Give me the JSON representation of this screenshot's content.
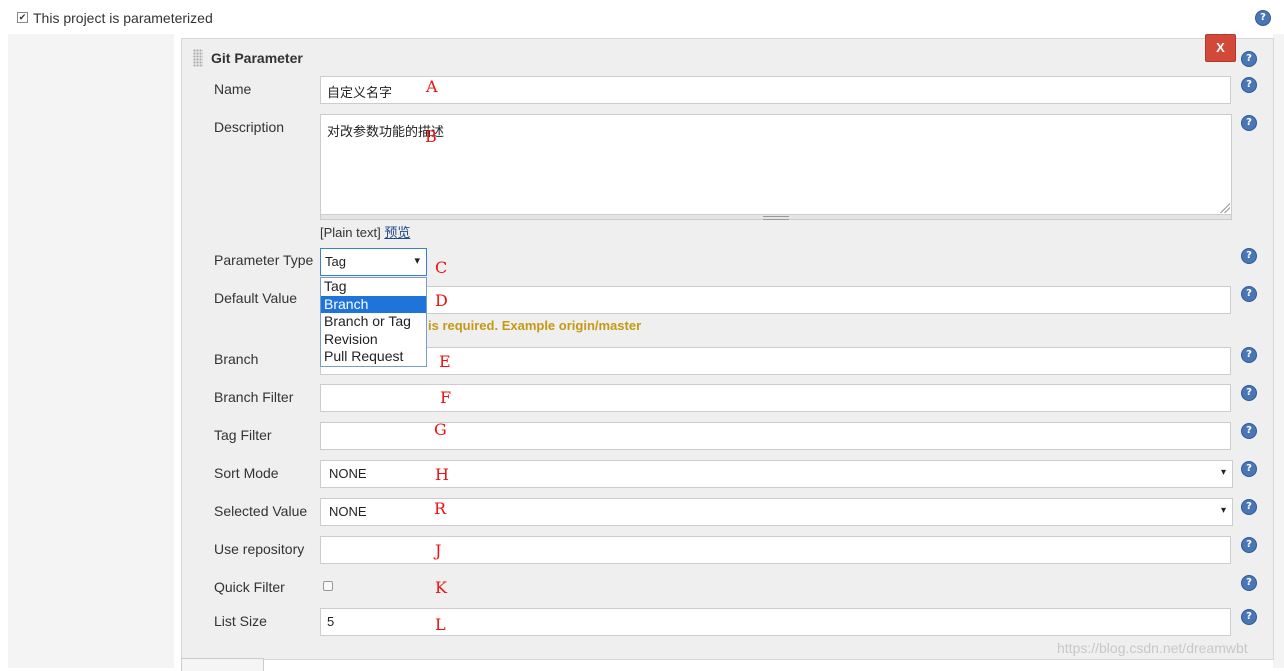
{
  "header": {
    "checkbox_label": "This project is parameterized",
    "checked": true
  },
  "panel": {
    "title": "Git Parameter",
    "delete_label": "X"
  },
  "fields": {
    "name": {
      "label": "Name",
      "value": "自定义名字"
    },
    "description": {
      "label": "Description",
      "value": "对改参数功能的描述",
      "plain_text": "[Plain text]",
      "preview_link": "预览"
    },
    "parameter_type": {
      "label": "Parameter Type",
      "value": "Tag",
      "options": [
        "Tag",
        "Branch",
        "Branch or Tag",
        "Revision",
        "Pull Request"
      ],
      "highlighted": "Branch"
    },
    "default_value": {
      "label": "Default Value",
      "warning": "is required. Example origin/master"
    },
    "branch": {
      "label": "Branch"
    },
    "branch_filter": {
      "label": "Branch Filter"
    },
    "tag_filter": {
      "label": "Tag Filter"
    },
    "sort_mode": {
      "label": "Sort Mode",
      "value": "NONE"
    },
    "selected_value": {
      "label": "Selected Value",
      "value": "NONE"
    },
    "use_repository": {
      "label": "Use repository"
    },
    "quick_filter": {
      "label": "Quick Filter",
      "checked": false
    },
    "list_size": {
      "label": "List Size",
      "value": "5"
    }
  },
  "annotations": {
    "a": "A",
    "b": "B",
    "c": "C",
    "d": "D",
    "e": "E",
    "f": "F",
    "g": "G",
    "h": "H",
    "r": "R",
    "j": "J",
    "k": "K",
    "l": "L"
  },
  "help_icon_glyph": "?",
  "dropdown_caret": "▾",
  "watermark": "https://blog.csdn.net/dreamwbt",
  "colors": {
    "accent": "#1e74d8",
    "delete": "#d24939",
    "warning": "#c49a14",
    "annotation": "#ee1111"
  }
}
